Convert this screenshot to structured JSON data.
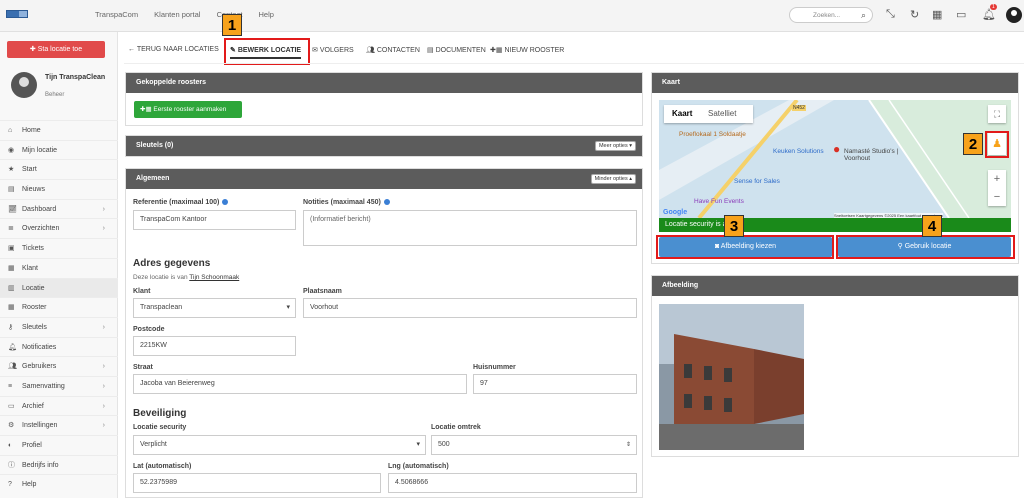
{
  "topbar": {
    "nav": [
      "TranspaCom",
      "Klanten portal",
      "Contact",
      "Help"
    ],
    "search_placeholder": "Zoeken...",
    "notification_count": "1"
  },
  "sidebar": {
    "add_location_label": "Sta locatie toe",
    "user": {
      "name": "Tijn TranspaClean",
      "role": "Beheer"
    },
    "items": [
      {
        "label": "Home",
        "icon": "home-icon",
        "chev": false
      },
      {
        "label": "Mijn locatie",
        "icon": "location-icon",
        "chev": false
      },
      {
        "label": "Start",
        "icon": "star-icon",
        "chev": false
      },
      {
        "label": "Nieuws",
        "icon": "news-icon",
        "chev": false
      },
      {
        "label": "Dashboard",
        "icon": "chart-icon",
        "chev": true
      },
      {
        "label": "Overzichten",
        "icon": "list-icon",
        "chev": true
      },
      {
        "label": "Tickets",
        "icon": "ticket-icon",
        "chev": false
      },
      {
        "label": "Klant",
        "icon": "client-icon",
        "chev": false
      },
      {
        "label": "Locatie",
        "icon": "building-icon",
        "chev": false,
        "active": true
      },
      {
        "label": "Rooster",
        "icon": "calendar-icon",
        "chev": false
      },
      {
        "label": "Sleutels",
        "icon": "key-icon",
        "chev": true
      },
      {
        "label": "Notificaties",
        "icon": "bell-icon",
        "chev": false
      },
      {
        "label": "Gebruikers",
        "icon": "users-icon",
        "chev": true
      },
      {
        "label": "Samenvatting",
        "icon": "summary-icon",
        "chev": true
      },
      {
        "label": "Archief",
        "icon": "archive-icon",
        "chev": true
      },
      {
        "label": "Instellingen",
        "icon": "gear-icon",
        "chev": true
      },
      {
        "label": "Profiel",
        "icon": "profile-icon",
        "chev": false
      },
      {
        "label": "Bedrijfs info",
        "icon": "info-icon",
        "chev": false
      },
      {
        "label": "Help",
        "icon": "help-icon",
        "chev": false
      }
    ]
  },
  "tabs": {
    "back": "TERUG NAAR LOCATIES",
    "edit": "BEWERK LOCATIE",
    "followers": "VOLGERS",
    "contacts": "CONTACTEN",
    "documents": "DOCUMENTEN",
    "new_schedule": "NIEUW ROOSTER"
  },
  "callouts": [
    "1",
    "2",
    "3",
    "4"
  ],
  "schedules": {
    "title": "Gekoppelde roosters",
    "create_button": "Eerste rooster aanmaken"
  },
  "keys": {
    "title": "Sleutels (0)",
    "options": "Meer opties"
  },
  "general": {
    "title": "Algemeen",
    "options": "Minder opties",
    "reference_label": "Referentie (maximaal 100)",
    "reference_value": "TranspaCom Kantoor",
    "notes_label": "Notities (maximaal 450)",
    "notes_placeholder": "(Informatief bericht)",
    "address_title": "Adres gegevens",
    "address_note": "Deze locatie is van",
    "address_owner": "Tijn Schoonmaak",
    "client_label": "Klant",
    "client_value": "Transpaclean",
    "city_label": "Plaatsnaam",
    "city_value": "Voorhout",
    "postcode_label": "Postcode",
    "postcode_value": "2215KW",
    "street_label": "Straat",
    "street_value": "Jacoba van Beierenweg",
    "housenumber_label": "Huisnummer",
    "housenumber_value": "97",
    "security_title": "Beveiliging",
    "security_label": "Locatie security",
    "security_value": "Verplicht",
    "radius_label": "Locatie omtrek",
    "radius_value": "500",
    "lat_label": "Lat (automatisch)",
    "lat_value": "52.2375989",
    "lng_label": "Lng (automatisch)",
    "lng_value": "4.5068666"
  },
  "map": {
    "title": "Kaart",
    "type_map": "Kaart",
    "type_sat": "Satelliet",
    "security_text": "Locatie security is a",
    "choose_image": "Afbeelding kiezen",
    "use_location": "Gebruik locatie",
    "labels": [
      "Proeflokaal 1 Soldaatje",
      "Keuken Solutions",
      "Namasté Studio's | Voorhout",
      "Sense for Sales",
      "Have Fun Events",
      "N452"
    ],
    "keyboard_note": "Sneltoetsen",
    "mapdata": "Kaartgegevens ©2025",
    "terms": "Een kaartfout rapporteren"
  },
  "image_panel": {
    "title": "Afbeelding"
  }
}
